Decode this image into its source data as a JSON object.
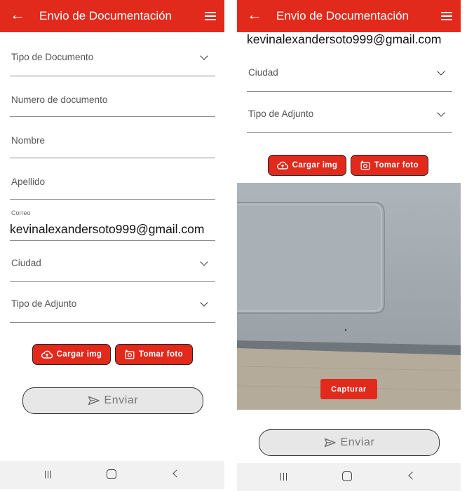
{
  "appbar": {
    "title": "Envio de Documentación",
    "back_icon": "arrow-back-icon",
    "menu_icon": "hamburger-menu-icon"
  },
  "form": {
    "tipo_documento": "Tipo de Documento",
    "numero_documento": "Numero de documento",
    "nombre": "Nombre",
    "apellido": "Apellido",
    "correo_label": "Correo",
    "correo_value": "kevinalexandersoto999@gmail.com",
    "ciudad": "Ciudad",
    "tipo_adjunto": "Tipo de Adjunto"
  },
  "buttons": {
    "cargar": "Cargar img",
    "tomar": "Tomar foto",
    "enviar": "Enviar",
    "capturar": "Capturar"
  },
  "colors": {
    "accent": "#e12a1c",
    "send_bg": "#e7e7e7"
  }
}
